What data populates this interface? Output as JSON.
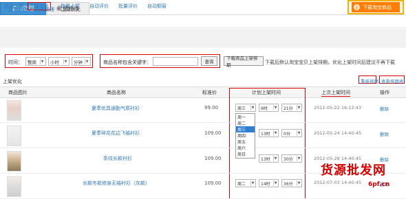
{
  "tabs": [
    "自动助理",
    "批量修改"
  ],
  "download_label": "下载淘宝商品",
  "subnav": [
    "自动上架",
    "上架优化",
    "批量上架",
    "自动评价",
    "批量评价",
    "自动橱窗"
  ],
  "breadcrumbs": [
    "店铺助理",
    "自动助理",
    "上架优化"
  ],
  "filter": {
    "time_label": "时间：",
    "week_value": "整周",
    "hour_value": "小时",
    "minute_value": "分钟",
    "keyword_label": "商品名称包含关键字：",
    "search_label": "查询",
    "download_btn": "下载商品上架排期",
    "note": "下载后默认淘宝宝贝上架排期，优化上架时间后建议不再下载"
  },
  "section": {
    "title": "上架优化",
    "refresh_link": "重新排期",
    "view_link": "查看排期表"
  },
  "table": {
    "headers": [
      "商品图片",
      "商品名称",
      "标准价",
      "计划上架时间",
      "上次上架时间",
      "操作"
    ],
    "rows": [
      {
        "name": "夏季优具通勤气质衬衫",
        "price": "99.00",
        "day": "周三",
        "hour": "9时",
        "minute": "21分",
        "last": "2012-05-22 16:12:43",
        "op": "删除"
      },
      {
        "name": "夏季碎花花边飞袖衬衫",
        "price": "109.00",
        "day": "周一",
        "hour": "13时",
        "minute": "0分",
        "last": "2012-05-24 14:40:45",
        "op": "删除"
      },
      {
        "name": "条纹长款衬衫",
        "price": "109.00",
        "day": "周日",
        "hour": "13时",
        "minute": "30分",
        "last": "2012-05-28 14:40:45",
        "op": "删除"
      },
      {
        "name": "长款冬款修身无袖衬衫（灰款）",
        "price": "109.00",
        "day": "周二",
        "hour": "14时",
        "minute": "36分",
        "last": "2012-07-03 14:40:45",
        "op": "删除"
      }
    ]
  },
  "dropdown_options": [
    "周一",
    "周二",
    "周三",
    "周四",
    "周五",
    "周六",
    "周日"
  ],
  "dropdown_selected_index": 2,
  "watermark": {
    "line1": "货源批发网",
    "line2": "6pf.cn"
  },
  "colors": {
    "accent": "#3f93d4",
    "link": "#2f78b7",
    "highlight": "#e00000",
    "download": "#ff7d00"
  }
}
